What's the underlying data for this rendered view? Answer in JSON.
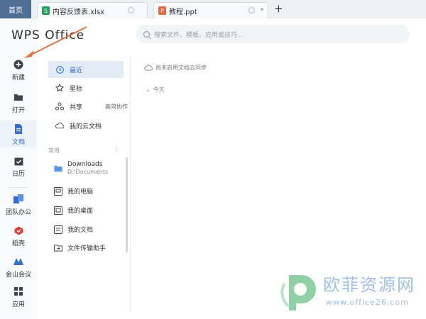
{
  "tabs": {
    "home": "首页",
    "xlsx": {
      "badge": "S",
      "label": "内容反馈表.xlsx"
    },
    "ppt": {
      "badge": "P",
      "label": "教程.ppt"
    },
    "add": "+"
  },
  "logo": "WPS Office",
  "search": {
    "placeholder": "搜索文件、模板、应用或技巧..."
  },
  "rail": {
    "new": "新建",
    "open": "打开",
    "docs": "文档",
    "calendar": "日历",
    "team": "团队办公",
    "draft": "稻壳",
    "meeting": "金山会议",
    "apps": "应用"
  },
  "nav": {
    "recent": "最近",
    "star": "星标",
    "share": "共享",
    "share_aside": "高效协作",
    "cloud": "我的云文档"
  },
  "common": {
    "label": "常用",
    "downloads": "Downloads",
    "downloads_path": "D:\\Documents",
    "pc": "我的电脑",
    "desktop": "我的桌面",
    "mydocs": "我的文档",
    "transfer": "文件传输助手"
  },
  "main": {
    "sync": "尚未启用文档云同步",
    "today": "今天"
  },
  "watermark": {
    "cn": "欧菲资源网",
    "url": "www.office26.com"
  },
  "colors": {
    "accent": "#2f6fd4",
    "tab_home_bg": "#4f6e96",
    "arrow": "#e8733a"
  }
}
